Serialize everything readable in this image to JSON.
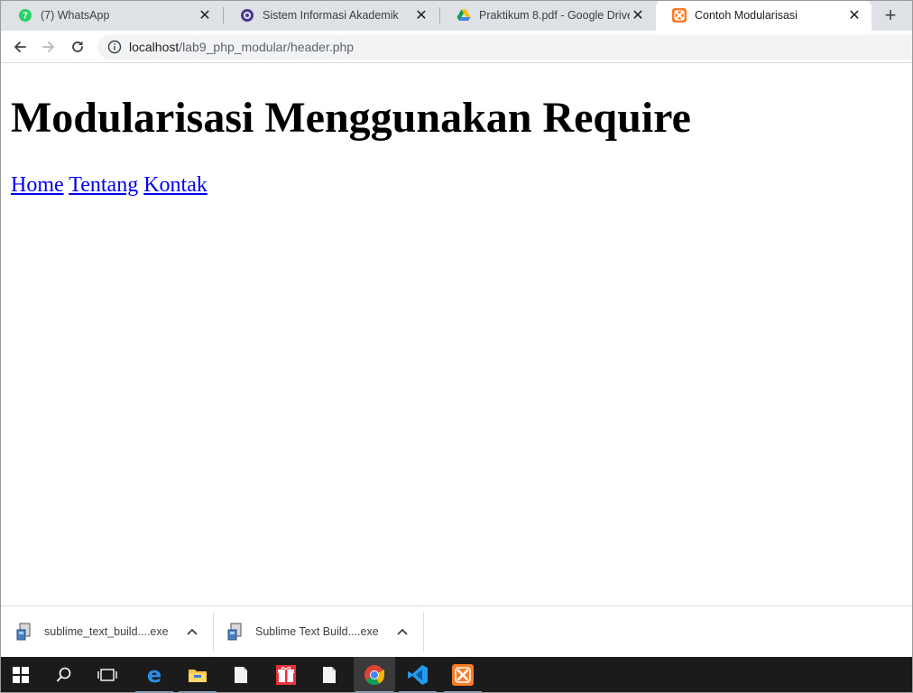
{
  "tabs": [
    {
      "title": "(7) WhatsApp",
      "icon": "whatsapp-icon",
      "active": false
    },
    {
      "title": "Sistem Informasi Akademik",
      "icon": "university-logo-icon",
      "active": false
    },
    {
      "title": "Praktikum 8.pdf - Google Drive",
      "icon": "google-drive-icon",
      "active": false
    },
    {
      "title": "Contoh Modularisasi",
      "icon": "xampp-icon",
      "active": true
    }
  ],
  "toolbar": {
    "url_host": "localhost",
    "url_path": "/lab9_php_modular/header.php"
  },
  "page": {
    "heading": "Modularisasi Menggunakan Require",
    "links": [
      "Home",
      "Tentang",
      "Kontak"
    ]
  },
  "downloads": [
    {
      "filename": "sublime_text_build....exe"
    },
    {
      "filename": "Sublime Text Build....exe"
    }
  ],
  "taskbar": {
    "items": [
      "windows-start-icon",
      "search-icon",
      "task-view-icon",
      "edge-icon",
      "file-explorer-icon",
      "file-icon",
      "gift-app-icon",
      "file-icon",
      "chrome-icon",
      "vscode-icon",
      "xampp-icon"
    ]
  },
  "colors": {
    "link": "#0000ee",
    "tabstrip": "#dee1e6",
    "taskbar": "#1b1b1b"
  }
}
